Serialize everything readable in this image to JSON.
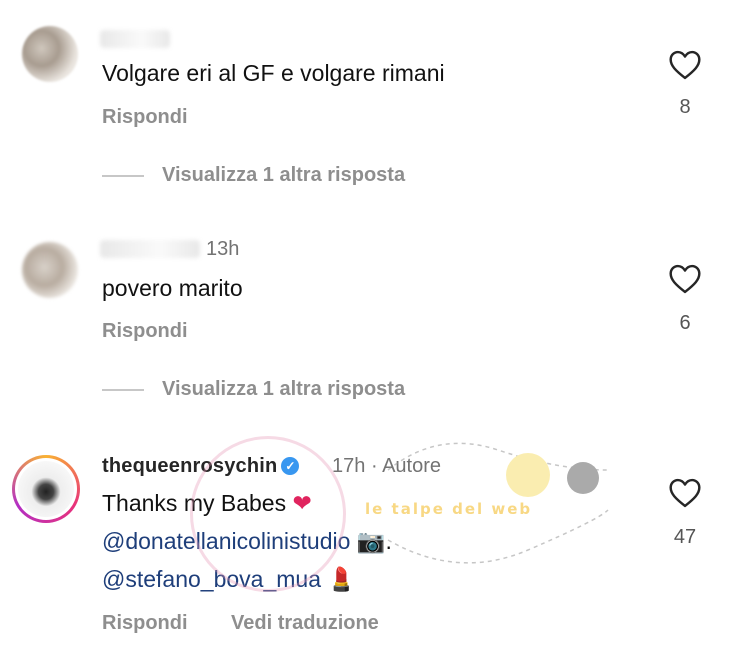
{
  "comments": [
    {
      "text": "Volgare eri al GF e volgare rimani",
      "reply_label": "Rispondi",
      "view_replies": "Visualizza 1 altra risposta",
      "likes": "8"
    },
    {
      "time": "13h",
      "text": "povero marito",
      "reply_label": "Rispondi",
      "view_replies": "Visualizza 1 altra risposta",
      "likes": "6"
    },
    {
      "username": "thequeenrosychin",
      "time": "17h",
      "separator": "·",
      "author_badge": "Autore",
      "text_line1": "Thanks my Babes",
      "text_line1_emoji": "❤",
      "mention1": "@donatellanicolinistudio",
      "mention1_emoji": "📷",
      "mention1_suffix": ".",
      "mention2": "@stefano_bova_mua",
      "mention2_emoji": "💄",
      "reply_label": "Rispondi",
      "translate_label": "Vedi traduzione",
      "likes": "47"
    }
  ],
  "watermark": {
    "text": "le talpe del web"
  },
  "colors": {
    "accent_heart": "#262626",
    "mention": "#1e3e7a",
    "muted": "#8e8e8e",
    "verified": "#3897f0"
  }
}
